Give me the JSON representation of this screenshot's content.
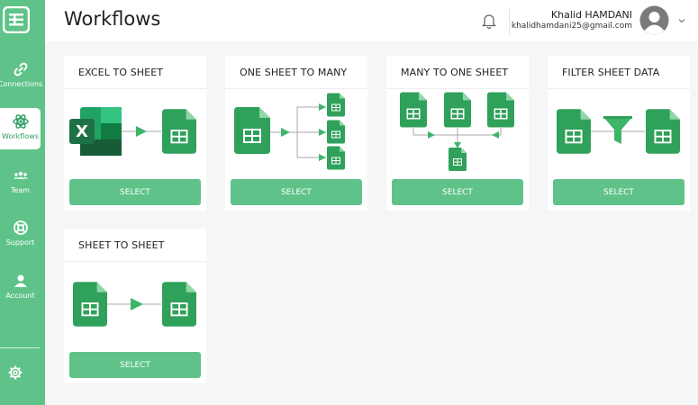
{
  "app": {
    "page_title": "Workflows"
  },
  "sidebar": {
    "items": [
      {
        "label": "Connections",
        "icon": "link-icon"
      },
      {
        "label": "Workflows",
        "icon": "atom-icon"
      },
      {
        "label": "Team",
        "icon": "team-icon"
      },
      {
        "label": "Support",
        "icon": "support-icon"
      },
      {
        "label": "Account",
        "icon": "user-icon"
      }
    ],
    "settings_icon": "gear-icon"
  },
  "header": {
    "user_name": "Khalid HAMDANI",
    "user_email": "khalidhamdani25@gmail.com"
  },
  "cards": [
    {
      "title": "EXCEL TO SHEET",
      "button": "SELECT"
    },
    {
      "title": "ONE SHEET TO MANY",
      "button": "SELECT"
    },
    {
      "title": "MANY TO ONE SHEET",
      "button": "SELECT"
    },
    {
      "title": "FILTER SHEET DATA",
      "button": "SELECT"
    },
    {
      "title": "SHEET TO SHEET",
      "button": "SELECT"
    }
  ],
  "colors": {
    "brand": "#5fc389",
    "sheet_green": "#2fa15a",
    "excel_green": "#1e7145"
  }
}
